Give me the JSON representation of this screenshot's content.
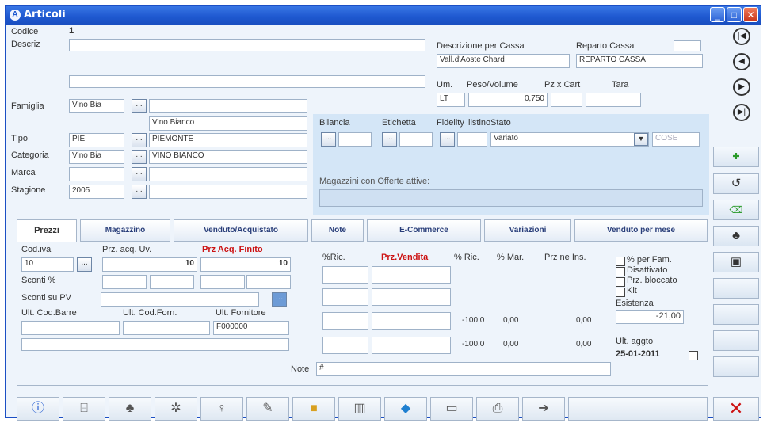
{
  "window": {
    "title": "Articoli",
    "title_icon": "A"
  },
  "form": {
    "codice_label": "Codice",
    "codice_value": "1",
    "descriz_label": "Descriz",
    "famiglia_label": "Famiglia",
    "famiglia_code": "Vino Bia",
    "famiglia_desc": "Vino Bianco",
    "tipo_label": "Tipo",
    "tipo_code": "PIE",
    "tipo_desc": "PIEMONTE",
    "categoria_label": "Categoria",
    "categoria_code": "Vino Bia",
    "categoria_desc": "VINO BIANCO",
    "marca_label": "Marca",
    "stagione_label": "Stagione",
    "stagione_code": "2005",
    "descr_cassa_label": "Descrizione per Cassa",
    "descr_cassa_value": "Vall.d'Aoste Chard",
    "reparto_label": "Reparto Cassa",
    "reparto_value": "REPARTO CASSA",
    "um_label": "Um.",
    "um_value": "LT",
    "peso_label": "Peso/Volume",
    "peso_value": "0,750",
    "pzcont_label": "Pz x Cart",
    "tara_label": "Tara",
    "bilancia_label": "Bilancia",
    "etichetta_label": "Etichetta",
    "fidelity_label": "Fidelity",
    "listino_label": "listino",
    "stato_label": "Stato",
    "stato_value": "Variato",
    "cose_label": "COSE",
    "magazzini_offerte_label": "Magazzini con Offerte attive:"
  },
  "tabs": [
    "Prezzi",
    "Magazzino",
    "Venduto/Acquistato",
    "Note",
    "E-Commerce",
    "Variazioni",
    "Venduto per mese"
  ],
  "prezzi": {
    "codiva_label": "Cod.iva",
    "codiva_value": "10",
    "przacq_label": "Prz. acq. Uv.",
    "przacq_value": "10",
    "przacqfinito_label": "Prz Acq. Finito",
    "przacqfinito_value": "10",
    "sconti_label": "Sconti %",
    "scontipv_label": "Sconti su PV",
    "ultcodbarre_label": "Ult. Cod.Barre",
    "ultcodforn_label": "Ult. Cod.Forn.",
    "ultfornitore_label": "Ult. Fornitore",
    "ultfornitore_value": "F000000",
    "note_label": "Note",
    "note_value": "#",
    "nric_label": "%Ric.",
    "przvendita_label": "Prz.Vendita",
    "przvendita_value": "",
    "pric_label": "% Ric.",
    "pmar_label": "% Mar.",
    "przneins_label": "Prz ne Ins.",
    "row3_ric": "-100,0",
    "row3_mar": "0,00",
    "row3_prz": "0,00",
    "row4_ric": "-100,0",
    "row4_mar": "0,00",
    "row4_prz": "0,00",
    "perfam_label": "% per Fam.",
    "disattivato_label": "Disattivato",
    "prz_bloccato_label": "Prz. bloccato",
    "kit_label": "Kit",
    "esistenza_label": "Esistenza",
    "esistenza_value": "-21,00",
    "ultaggto_label": "Ult. aggto",
    "ultaggto_value": "25-01-2011"
  },
  "icons": {
    "info": "ⓘ",
    "calc": "⌸",
    "binoculars": "♣",
    "save": "▣",
    "close": "✕"
  }
}
